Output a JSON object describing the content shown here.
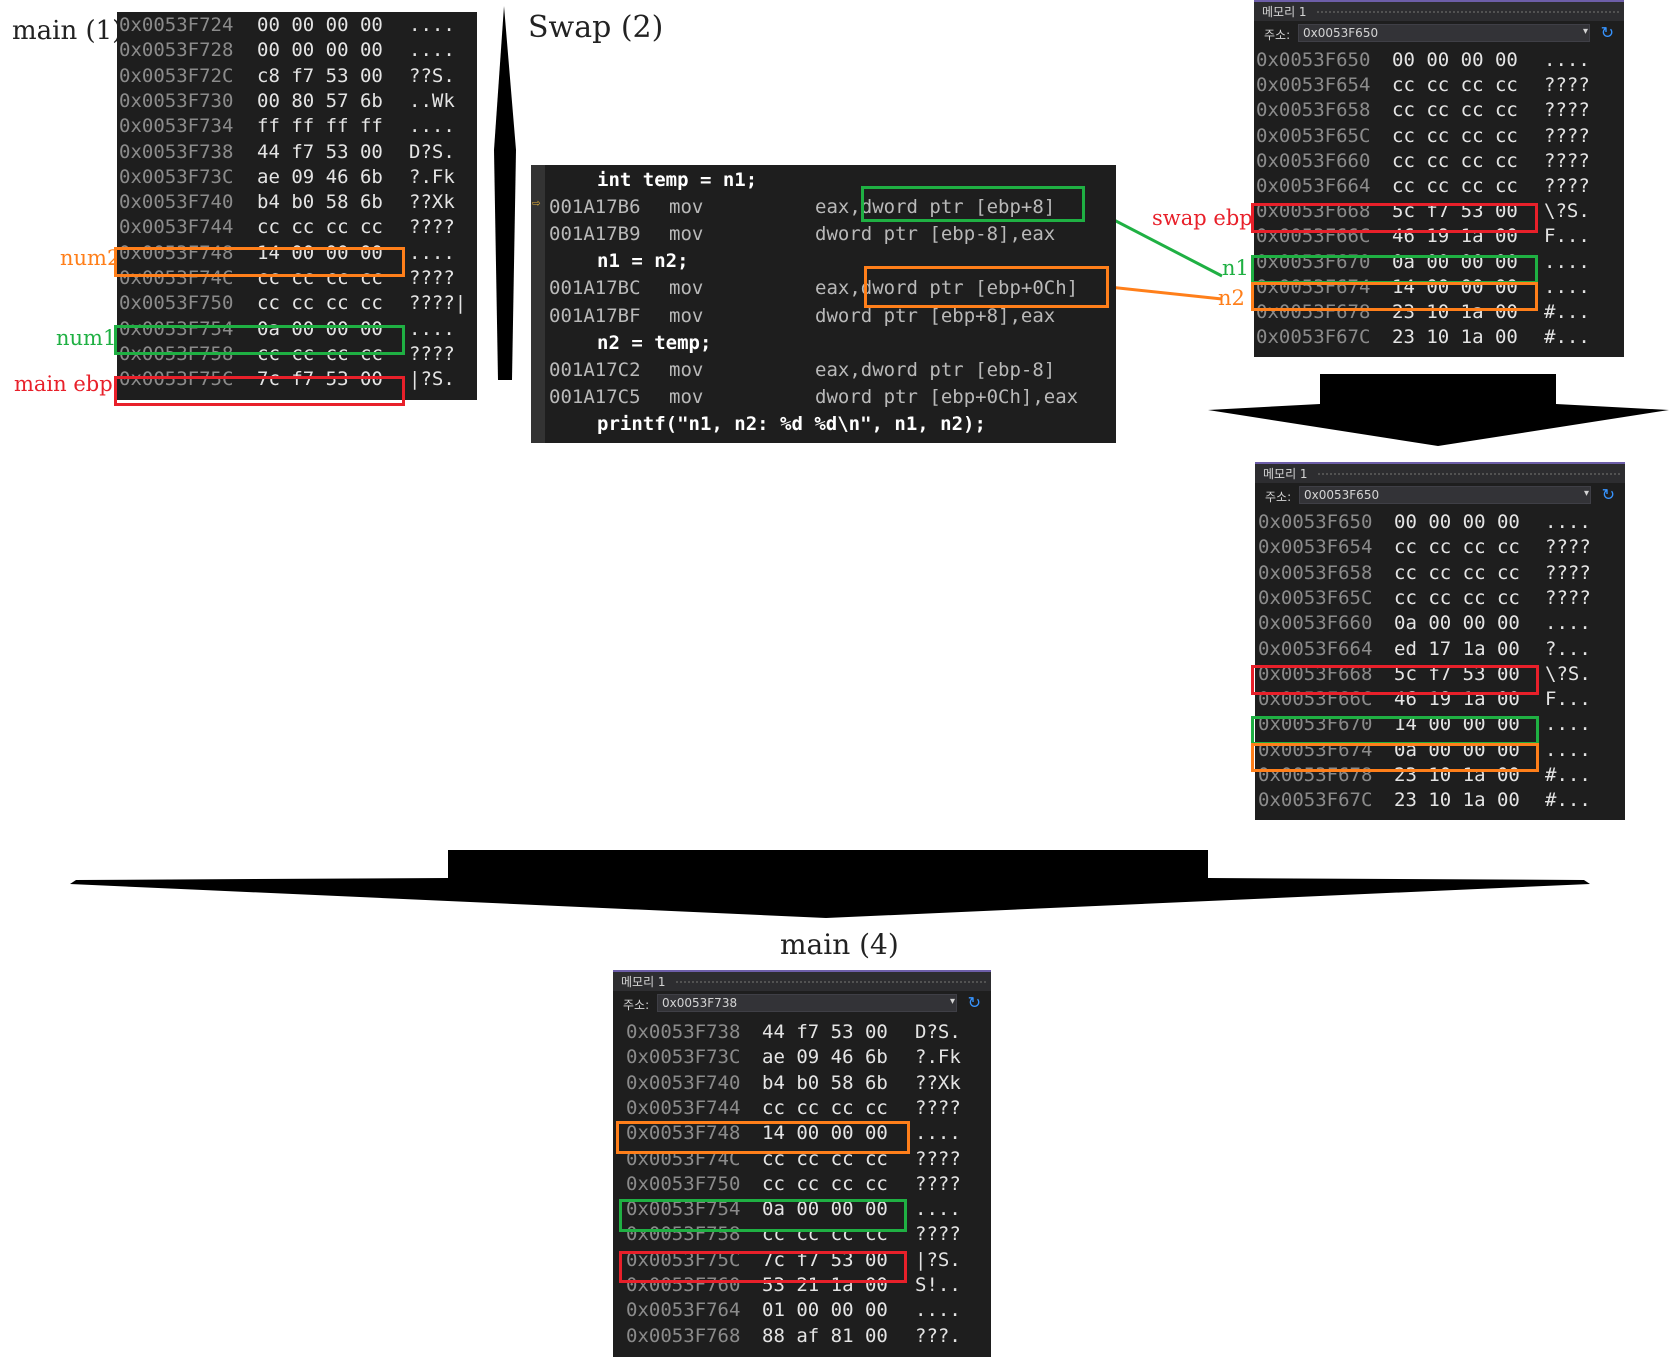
{
  "captions": {
    "main1": "main (1)",
    "swap2": "Swap (2)",
    "main4": "main (4)"
  },
  "tags": {
    "num2": "num2",
    "num1": "num1",
    "main_ebp": "main ebp",
    "swap_ebp": "swap ebp",
    "n1": "n1",
    "n2": "n2"
  },
  "colors": {
    "red": "#e8202a",
    "green": "#1fb043",
    "orange": "#ff7f1a",
    "panel_bg": "#1e1e1e",
    "accent": "#6d5ea9"
  },
  "memory_main1": {
    "rows": [
      {
        "addr": "0x0053F724",
        "hex": "00 00 00 00",
        "chars": "...."
      },
      {
        "addr": "0x0053F728",
        "hex": "00 00 00 00",
        "chars": "...."
      },
      {
        "addr": "0x0053F72C",
        "hex": "c8 f7 53 00",
        "chars": "??S."
      },
      {
        "addr": "0x0053F730",
        "hex": "00 80 57 6b",
        "chars": "..Wk"
      },
      {
        "addr": "0x0053F734",
        "hex": "ff ff ff ff",
        "chars": "...."
      },
      {
        "addr": "0x0053F738",
        "hex": "44 f7 53 00",
        "chars": "D?S."
      },
      {
        "addr": "0x0053F73C",
        "hex": "ae 09 46 6b",
        "chars": "?.Fk"
      },
      {
        "addr": "0x0053F740",
        "hex": "b4 b0 58 6b",
        "chars": "??Xk"
      },
      {
        "addr": "0x0053F744",
        "hex": "cc cc cc cc",
        "chars": "????"
      },
      {
        "addr": "0x0053F748",
        "hex": "14 00 00 00",
        "chars": "...."
      },
      {
        "addr": "0x0053F74C",
        "hex": "cc cc cc cc",
        "chars": "????"
      },
      {
        "addr": "0x0053F750",
        "hex": "cc cc cc cc",
        "chars": "????|"
      },
      {
        "addr": "0x0053F754",
        "hex": "0a 00 00 00",
        "chars": "...."
      },
      {
        "addr": "0x0053F758",
        "hex": "cc cc cc cc",
        "chars": "????"
      },
      {
        "addr": "0x0053F75C",
        "hex": "7c f7 53 00",
        "chars": "|?S."
      }
    ]
  },
  "code_view": {
    "lines": [
      {
        "kind": "src",
        "text": "int temp = n1;"
      },
      {
        "kind": "asm",
        "addr": "001A17B6",
        "op": "mov",
        "args": "eax,dword ptr [ebp+8]"
      },
      {
        "kind": "asm",
        "addr": "001A17B9",
        "op": "mov",
        "args": "dword ptr [ebp-8],eax"
      },
      {
        "kind": "src",
        "text": "n1 = n2;"
      },
      {
        "kind": "asm",
        "addr": "001A17BC",
        "op": "mov",
        "args": "eax,dword ptr [ebp+0Ch]"
      },
      {
        "kind": "asm",
        "addr": "001A17BF",
        "op": "mov",
        "args": "dword ptr [ebp+8],eax"
      },
      {
        "kind": "src",
        "text": "n2 = temp;"
      },
      {
        "kind": "asm",
        "addr": "001A17C2",
        "op": "mov",
        "args": "eax,dword ptr [ebp-8]"
      },
      {
        "kind": "asm",
        "addr": "001A17C5",
        "op": "mov",
        "args": "dword ptr [ebp+0Ch],eax"
      },
      {
        "kind": "src",
        "text": "printf(\"n1, n2: %d %d\\n\", n1, n2);"
      }
    ]
  },
  "memory_swap_before": {
    "title": "메모리 1",
    "address_label": "주소:",
    "address_value": "0x0053F650",
    "rows": [
      {
        "addr": "0x0053F650",
        "hex": "00 00 00 00",
        "chars": "...."
      },
      {
        "addr": "0x0053F654",
        "hex": "cc cc cc cc",
        "chars": "????"
      },
      {
        "addr": "0x0053F658",
        "hex": "cc cc cc cc",
        "chars": "????"
      },
      {
        "addr": "0x0053F65C",
        "hex": "cc cc cc cc",
        "chars": "????"
      },
      {
        "addr": "0x0053F660",
        "hex": "cc cc cc cc",
        "chars": "????"
      },
      {
        "addr": "0x0053F664",
        "hex": "cc cc cc cc",
        "chars": "????"
      },
      {
        "addr": "0x0053F668",
        "hex": "5c f7 53 00",
        "chars": "\\?S."
      },
      {
        "addr": "0x0053F66C",
        "hex": "46 19 1a 00",
        "chars": "F..."
      },
      {
        "addr": "0x0053F670",
        "hex": "0a 00 00 00",
        "chars": "...."
      },
      {
        "addr": "0x0053F674",
        "hex": "14 00 00 00",
        "chars": "...."
      },
      {
        "addr": "0x0053F678",
        "hex": "23 10 1a 00",
        "chars": "#..."
      },
      {
        "addr": "0x0053F67C",
        "hex": "23 10 1a 00",
        "chars": "#..."
      }
    ]
  },
  "memory_swap_after": {
    "title": "메모리 1",
    "address_label": "주소:",
    "address_value": "0x0053F650",
    "rows": [
      {
        "addr": "0x0053F650",
        "hex": "00 00 00 00",
        "chars": "...."
      },
      {
        "addr": "0x0053F654",
        "hex": "cc cc cc cc",
        "chars": "????"
      },
      {
        "addr": "0x0053F658",
        "hex": "cc cc cc cc",
        "chars": "????"
      },
      {
        "addr": "0x0053F65C",
        "hex": "cc cc cc cc",
        "chars": "????"
      },
      {
        "addr": "0x0053F660",
        "hex": "0a 00 00 00",
        "chars": "...."
      },
      {
        "addr": "0x0053F664",
        "hex": "ed 17 1a 00",
        "chars": "?..."
      },
      {
        "addr": "0x0053F668",
        "hex": "5c f7 53 00",
        "chars": "\\?S."
      },
      {
        "addr": "0x0053F66C",
        "hex": "46 19 1a 00",
        "chars": "F..."
      },
      {
        "addr": "0x0053F670",
        "hex": "14 00 00 00",
        "chars": "...."
      },
      {
        "addr": "0x0053F674",
        "hex": "0a 00 00 00",
        "chars": "...."
      },
      {
        "addr": "0x0053F678",
        "hex": "23 10 1a 00",
        "chars": "#..."
      },
      {
        "addr": "0x0053F67C",
        "hex": "23 10 1a 00",
        "chars": "#..."
      }
    ]
  },
  "memory_main4": {
    "title": "메모리 1",
    "address_label": "주소:",
    "address_value": "0x0053F738",
    "rows": [
      {
        "addr": "0x0053F738",
        "hex": "44 f7 53 00",
        "chars": "D?S."
      },
      {
        "addr": "0x0053F73C",
        "hex": "ae 09 46 6b",
        "chars": "?.Fk"
      },
      {
        "addr": "0x0053F740",
        "hex": "b4 b0 58 6b",
        "chars": "??Xk"
      },
      {
        "addr": "0x0053F744",
        "hex": "cc cc cc cc",
        "chars": "????"
      },
      {
        "addr": "0x0053F748",
        "hex": "14 00 00 00",
        "chars": "...."
      },
      {
        "addr": "0x0053F74C",
        "hex": "cc cc cc cc",
        "chars": "????"
      },
      {
        "addr": "0x0053F750",
        "hex": "cc cc cc cc",
        "chars": "????"
      },
      {
        "addr": "0x0053F754",
        "hex": "0a 00 00 00",
        "chars": "...."
      },
      {
        "addr": "0x0053F758",
        "hex": "cc cc cc cc",
        "chars": "????"
      },
      {
        "addr": "0x0053F75C",
        "hex": "7c f7 53 00",
        "chars": "|?S."
      },
      {
        "addr": "0x0053F760",
        "hex": "53 21 1a 00",
        "chars": "S!.."
      },
      {
        "addr": "0x0053F764",
        "hex": "01 00 00 00",
        "chars": "...."
      },
      {
        "addr": "0x0053F768",
        "hex": "88 af 81 00",
        "chars": "???."
      }
    ]
  }
}
